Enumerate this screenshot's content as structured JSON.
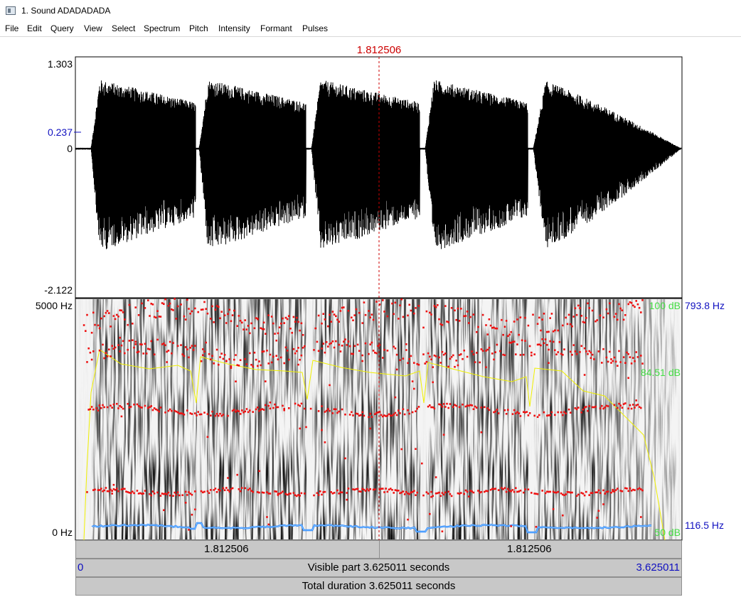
{
  "window": {
    "title": "1. Sound ADADADADA"
  },
  "menu": [
    "File",
    "Edit",
    "Query",
    "View",
    "Select",
    "Spectrum",
    "Pitch",
    "Intensity",
    "Formant",
    "Pulses"
  ],
  "cursor_time": "1.812506",
  "waveform": {
    "y_max_label": "1.303",
    "y_cursor_label": "0.237",
    "y_zero_label": "0",
    "y_min_label": "-2.122"
  },
  "spectrogram": {
    "freq_top_label": "5000 Hz",
    "freq_bottom_label": "0 Hz",
    "intensity_top_label": "100 dB",
    "intensity_mid_label": "84.51 dB",
    "intensity_bottom_label": "50 dB",
    "pitch_top_label": "793.8 Hz",
    "pitch_bottom_label": "116.5 Hz"
  },
  "time_bar": {
    "left_segment": "1.812506",
    "right_segment": "1.812506",
    "visible_start": "0",
    "visible_label": "Visible part 3.625011 seconds",
    "visible_end": "3.625011",
    "total_label": "Total duration 3.625011 seconds"
  },
  "colors": {
    "cursor": "#cc0000",
    "formant": "#ee1111",
    "intensity": "#f0f000",
    "pitch": "#1f7fff",
    "axis_blue": "#1010c0",
    "db_green": "#44dd44"
  }
}
